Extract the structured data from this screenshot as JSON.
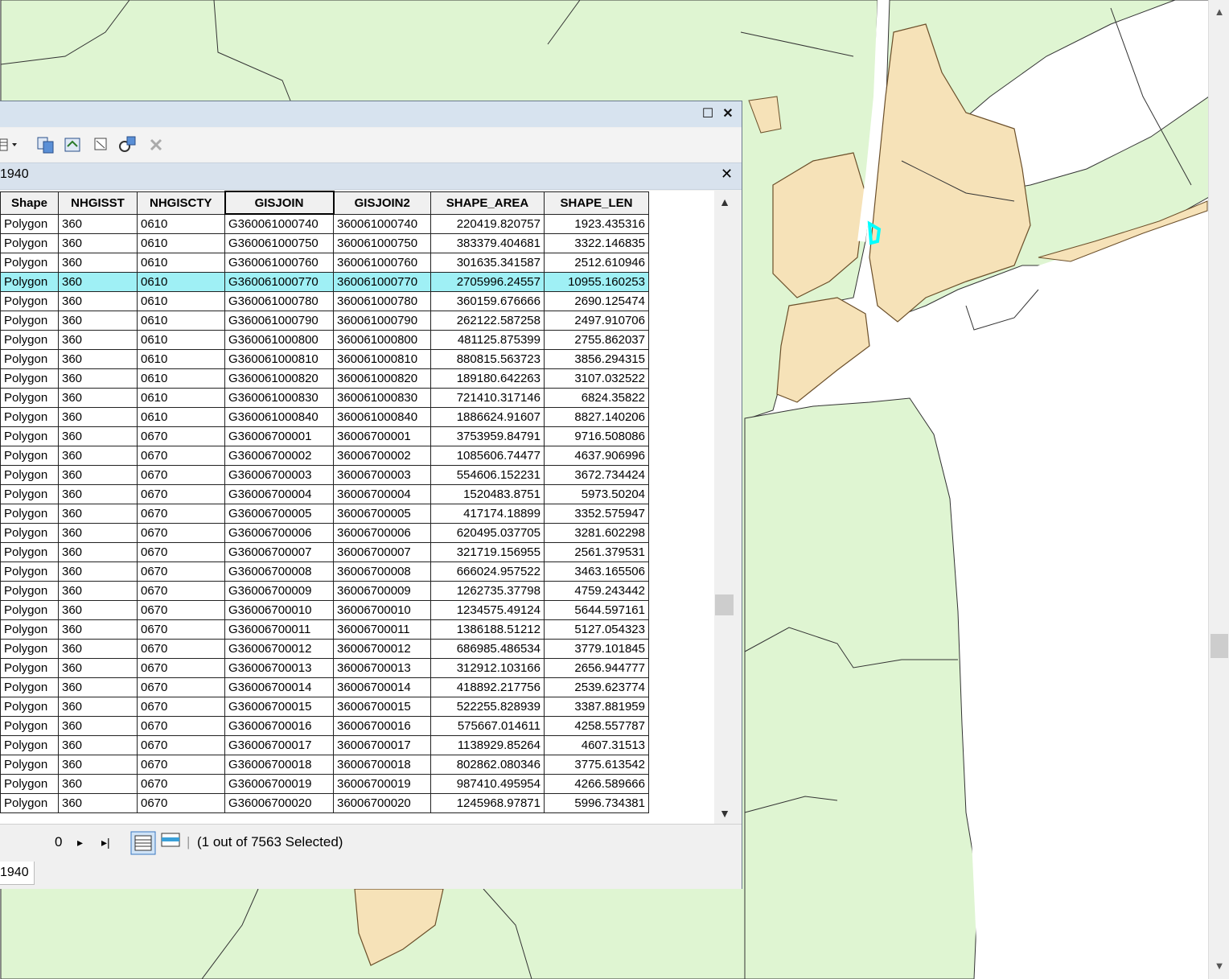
{
  "colors": {
    "land": "#dff5d2",
    "tracts": "#f6e2b8",
    "water": "#ffffff",
    "selected_row": "#9ff0f5",
    "selected_feature": "#00ffff"
  },
  "window": {
    "maximize_icon": "☐",
    "close_icon": "✕"
  },
  "table": {
    "tab_name": "1940",
    "tab_close": "✕",
    "bottom_tab": "1940",
    "columns": [
      "Shape",
      "NHGISST",
      "NHGISCTY",
      "GISJOIN",
      "GISJOIN2",
      "SHAPE_AREA",
      "SHAPE_LEN"
    ],
    "rows": [
      [
        "Polygon",
        "360",
        "0610",
        "G360061000740",
        "360061000740",
        "220419.820757",
        "1923.435316"
      ],
      [
        "Polygon",
        "360",
        "0610",
        "G360061000750",
        "360061000750",
        "383379.404681",
        "3322.146835"
      ],
      [
        "Polygon",
        "360",
        "0610",
        "G360061000760",
        "360061000760",
        "301635.341587",
        "2512.610946"
      ],
      [
        "Polygon",
        "360",
        "0610",
        "G360061000770",
        "360061000770",
        "2705996.24557",
        "10955.160253"
      ],
      [
        "Polygon",
        "360",
        "0610",
        "G360061000780",
        "360061000780",
        "360159.676666",
        "2690.125474"
      ],
      [
        "Polygon",
        "360",
        "0610",
        "G360061000790",
        "360061000790",
        "262122.587258",
        "2497.910706"
      ],
      [
        "Polygon",
        "360",
        "0610",
        "G360061000800",
        "360061000800",
        "481125.875399",
        "2755.862037"
      ],
      [
        "Polygon",
        "360",
        "0610",
        "G360061000810",
        "360061000810",
        "880815.563723",
        "3856.294315"
      ],
      [
        "Polygon",
        "360",
        "0610",
        "G360061000820",
        "360061000820",
        "189180.642263",
        "3107.032522"
      ],
      [
        "Polygon",
        "360",
        "0610",
        "G360061000830",
        "360061000830",
        "721410.317146",
        "6824.35822"
      ],
      [
        "Polygon",
        "360",
        "0610",
        "G360061000840",
        "360061000840",
        "1886624.91607",
        "8827.140206"
      ],
      [
        "Polygon",
        "360",
        "0670",
        "G36006700001",
        "36006700001",
        "3753959.84791",
        "9716.508086"
      ],
      [
        "Polygon",
        "360",
        "0670",
        "G36006700002",
        "36006700002",
        "1085606.74477",
        "4637.906996"
      ],
      [
        "Polygon",
        "360",
        "0670",
        "G36006700003",
        "36006700003",
        "554606.152231",
        "3672.734424"
      ],
      [
        "Polygon",
        "360",
        "0670",
        "G36006700004",
        "36006700004",
        "1520483.8751",
        "5973.50204"
      ],
      [
        "Polygon",
        "360",
        "0670",
        "G36006700005",
        "36006700005",
        "417174.18899",
        "3352.575947"
      ],
      [
        "Polygon",
        "360",
        "0670",
        "G36006700006",
        "36006700006",
        "620495.037705",
        "3281.602298"
      ],
      [
        "Polygon",
        "360",
        "0670",
        "G36006700007",
        "36006700007",
        "321719.156955",
        "2561.379531"
      ],
      [
        "Polygon",
        "360",
        "0670",
        "G36006700008",
        "36006700008",
        "666024.957522",
        "3463.165506"
      ],
      [
        "Polygon",
        "360",
        "0670",
        "G36006700009",
        "36006700009",
        "1262735.37798",
        "4759.243442"
      ],
      [
        "Polygon",
        "360",
        "0670",
        "G36006700010",
        "36006700010",
        "1234575.49124",
        "5644.597161"
      ],
      [
        "Polygon",
        "360",
        "0670",
        "G36006700011",
        "36006700011",
        "1386188.51212",
        "5127.054323"
      ],
      [
        "Polygon",
        "360",
        "0670",
        "G36006700012",
        "36006700012",
        "686985.486534",
        "3779.101845"
      ],
      [
        "Polygon",
        "360",
        "0670",
        "G36006700013",
        "36006700013",
        "312912.103166",
        "2656.944777"
      ],
      [
        "Polygon",
        "360",
        "0670",
        "G36006700014",
        "36006700014",
        "418892.217756",
        "2539.623774"
      ],
      [
        "Polygon",
        "360",
        "0670",
        "G36006700015",
        "36006700015",
        "522255.828939",
        "3387.881959"
      ],
      [
        "Polygon",
        "360",
        "0670",
        "G36006700016",
        "36006700016",
        "575667.014611",
        "4258.557787"
      ],
      [
        "Polygon",
        "360",
        "0670",
        "G36006700017",
        "36006700017",
        "1138929.85264",
        "4607.31513"
      ],
      [
        "Polygon",
        "360",
        "0670",
        "G36006700018",
        "36006700018",
        "802862.080346",
        "3775.613542"
      ],
      [
        "Polygon",
        "360",
        "0670",
        "G36006700019",
        "36006700019",
        "987410.495954",
        "4266.589666"
      ],
      [
        "Polygon",
        "360",
        "0670",
        "G36006700020",
        "36006700020",
        "1245968.97871",
        "5996.734381"
      ]
    ],
    "selected_row_index": 3
  },
  "status": {
    "record_number": "0",
    "next_icon": "▸",
    "last_icon": "▸|",
    "selection_text": "(1 out of 7563 Selected)"
  },
  "scroll": {
    "up": "▲",
    "down": "▼"
  }
}
